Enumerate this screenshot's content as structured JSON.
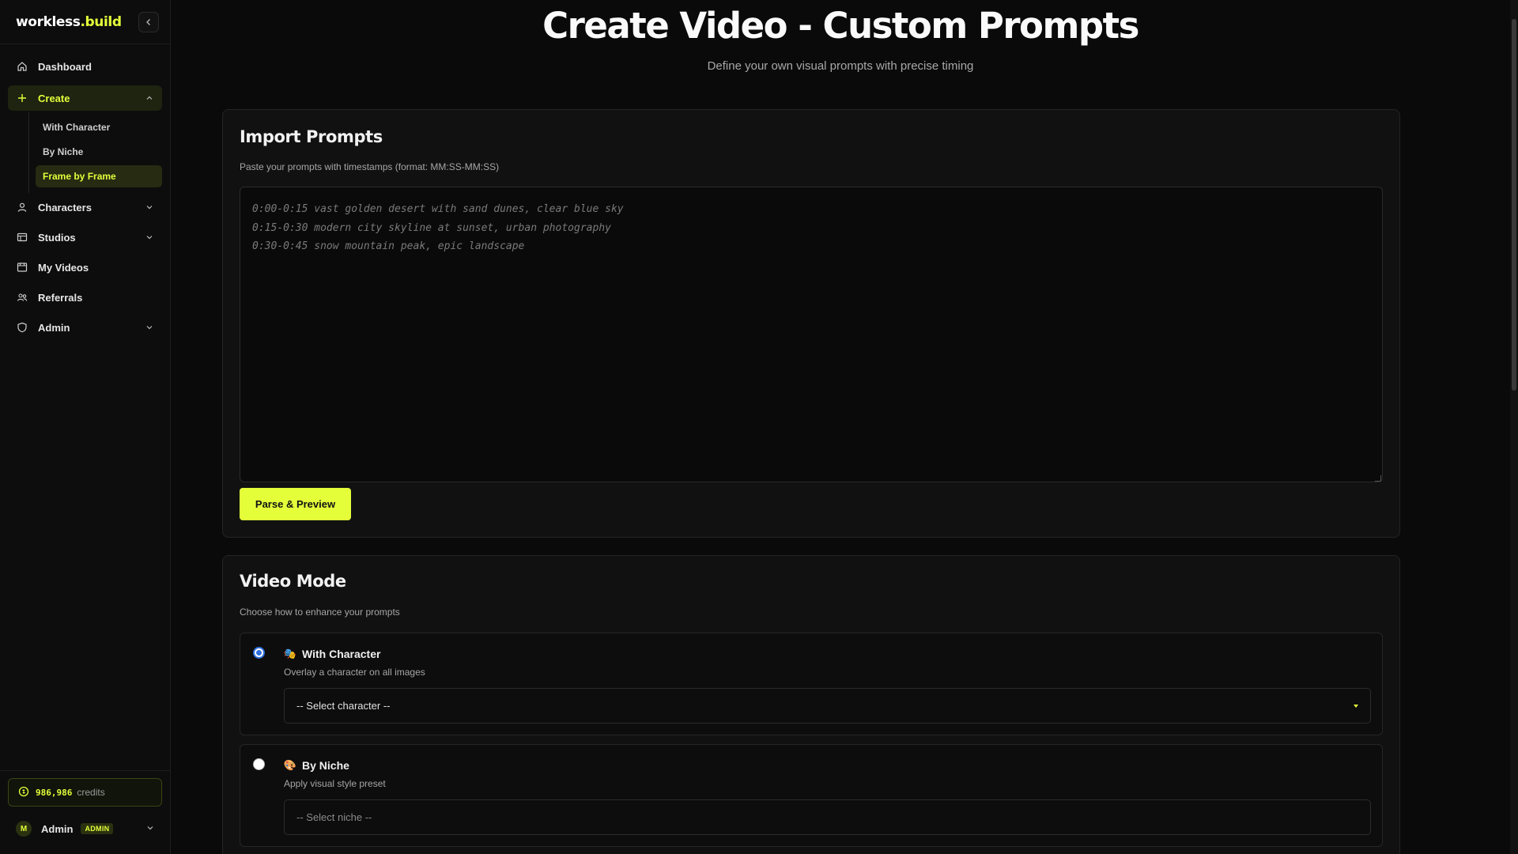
{
  "brand": {
    "name_part1": "workless",
    "name_part2": ".build"
  },
  "sidebar": {
    "items": [
      {
        "label": "Dashboard"
      },
      {
        "label": "Create"
      },
      {
        "label": "Characters"
      },
      {
        "label": "Studios"
      },
      {
        "label": "My Videos"
      },
      {
        "label": "Referrals"
      },
      {
        "label": "Admin"
      }
    ],
    "create_subitems": [
      {
        "label": "With Character"
      },
      {
        "label": "By Niche"
      },
      {
        "label": "Frame by Frame"
      }
    ]
  },
  "credits": {
    "value": "986,986",
    "label": "credits"
  },
  "user": {
    "initial": "M",
    "name": "Admin",
    "role": "ADMIN"
  },
  "header": {
    "title": "Create Video - Custom Prompts",
    "subtitle": "Define your own visual prompts with precise timing"
  },
  "import": {
    "title": "Import Prompts",
    "description": "Paste your prompts with timestamps (format: MM:SS-MM:SS)",
    "placeholder": "0:00-0:15 vast golden desert with sand dunes, clear blue sky\n0:15-0:30 modern city skyline at sunset, urban photography\n0:30-0:45 snow mountain peak, epic landscape",
    "button_label": "Parse & Preview"
  },
  "mode": {
    "title": "Video Mode",
    "description": "Choose how to enhance your prompts",
    "options": [
      {
        "emoji": "🎭",
        "title": "With Character",
        "description": "Overlay a character on all images",
        "select_value": "-- Select character --",
        "selected": true
      },
      {
        "emoji": "🎨",
        "title": "By Niche",
        "description": "Apply visual style preset",
        "select_value": "-- Select niche --",
        "selected": false
      }
    ]
  },
  "colors": {
    "accent": "#e4ff3a",
    "background": "#0a0a0a",
    "card": "#111111",
    "radio": "#2f6fe0"
  }
}
